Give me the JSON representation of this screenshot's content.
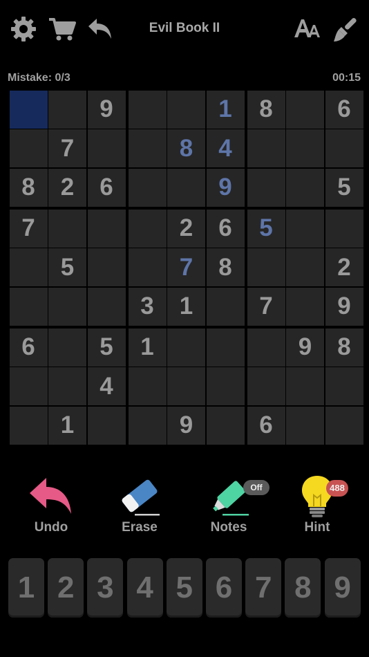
{
  "header": {
    "title": "Evil Book II",
    "icons": [
      "gear-icon",
      "cart-icon",
      "back-arrow-icon",
      "font-size-icon",
      "paintbrush-icon"
    ]
  },
  "status": {
    "mistakes": "Mistake: 0/3",
    "timer": "00:15"
  },
  "board": {
    "selected": [
      0,
      0
    ],
    "given_color": "#9a9a9a",
    "user_color": "#5e75a8",
    "selected_color": "#162a5c",
    "cells": [
      [
        [
          0,
          "g"
        ],
        [
          0,
          "g"
        ],
        [
          9,
          "g"
        ],
        [
          0,
          "g"
        ],
        [
          0,
          "g"
        ],
        [
          1,
          "u"
        ],
        [
          8,
          "g"
        ],
        [
          0,
          "g"
        ],
        [
          6,
          "g"
        ]
      ],
      [
        [
          0,
          "g"
        ],
        [
          7,
          "g"
        ],
        [
          0,
          "g"
        ],
        [
          0,
          "g"
        ],
        [
          8,
          "u"
        ],
        [
          4,
          "u"
        ],
        [
          0,
          "g"
        ],
        [
          0,
          "g"
        ],
        [
          0,
          "g"
        ]
      ],
      [
        [
          8,
          "g"
        ],
        [
          2,
          "g"
        ],
        [
          6,
          "g"
        ],
        [
          0,
          "g"
        ],
        [
          0,
          "g"
        ],
        [
          9,
          "u"
        ],
        [
          0,
          "g"
        ],
        [
          0,
          "g"
        ],
        [
          5,
          "g"
        ]
      ],
      [
        [
          7,
          "g"
        ],
        [
          0,
          "g"
        ],
        [
          0,
          "g"
        ],
        [
          0,
          "g"
        ],
        [
          2,
          "g"
        ],
        [
          6,
          "g"
        ],
        [
          5,
          "u"
        ],
        [
          0,
          "g"
        ],
        [
          0,
          "g"
        ]
      ],
      [
        [
          0,
          "g"
        ],
        [
          5,
          "g"
        ],
        [
          0,
          "g"
        ],
        [
          0,
          "g"
        ],
        [
          7,
          "u"
        ],
        [
          8,
          "g"
        ],
        [
          0,
          "g"
        ],
        [
          0,
          "g"
        ],
        [
          2,
          "g"
        ]
      ],
      [
        [
          0,
          "g"
        ],
        [
          0,
          "g"
        ],
        [
          0,
          "g"
        ],
        [
          3,
          "g"
        ],
        [
          1,
          "g"
        ],
        [
          0,
          "g"
        ],
        [
          7,
          "g"
        ],
        [
          0,
          "g"
        ],
        [
          9,
          "g"
        ]
      ],
      [
        [
          6,
          "g"
        ],
        [
          0,
          "g"
        ],
        [
          5,
          "g"
        ],
        [
          1,
          "g"
        ],
        [
          0,
          "g"
        ],
        [
          0,
          "g"
        ],
        [
          0,
          "g"
        ],
        [
          9,
          "g"
        ],
        [
          8,
          "g"
        ]
      ],
      [
        [
          0,
          "g"
        ],
        [
          0,
          "g"
        ],
        [
          4,
          "g"
        ],
        [
          0,
          "g"
        ],
        [
          0,
          "g"
        ],
        [
          0,
          "g"
        ],
        [
          0,
          "g"
        ],
        [
          0,
          "g"
        ],
        [
          0,
          "g"
        ]
      ],
      [
        [
          0,
          "g"
        ],
        [
          1,
          "g"
        ],
        [
          0,
          "g"
        ],
        [
          0,
          "g"
        ],
        [
          9,
          "g"
        ],
        [
          0,
          "g"
        ],
        [
          6,
          "g"
        ],
        [
          0,
          "g"
        ],
        [
          0,
          "g"
        ]
      ]
    ]
  },
  "tools": {
    "undo": {
      "label": "Undo",
      "color": "#e65a87"
    },
    "erase": {
      "label": "Erase",
      "color": "#4a86c5"
    },
    "notes": {
      "label": "Notes",
      "badge": "Off",
      "color": "#4ed3a3"
    },
    "hint": {
      "label": "Hint",
      "badge": "488",
      "color": "#f5d820",
      "badge_color": "#c85353"
    }
  },
  "numpad": [
    "1",
    "2",
    "3",
    "4",
    "5",
    "6",
    "7",
    "8",
    "9"
  ]
}
